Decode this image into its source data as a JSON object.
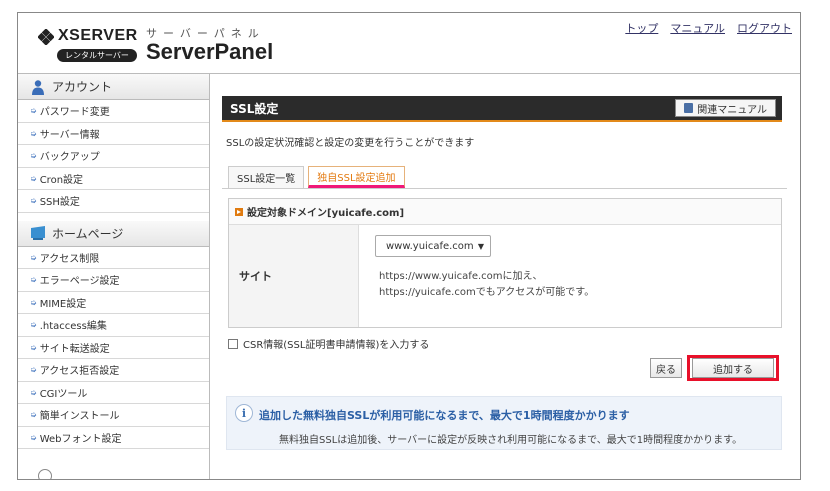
{
  "header": {
    "logo_text": "XSERVER",
    "logo_badge": "レンタルサーバー",
    "panel_kana": "サーバーパネル",
    "panel_title": "ServerPanel",
    "links": [
      "トップ",
      "マニュアル",
      "ログアウト"
    ]
  },
  "sidebar": {
    "account_heading": "アカウント",
    "account_items": [
      "パスワード変更",
      "サーバー情報",
      "バックアップ",
      "Cron設定",
      "SSH設定"
    ],
    "homepage_heading": "ホームページ",
    "homepage_items": [
      "アクセス制限",
      "エラーページ設定",
      "MIME設定",
      ".htaccess編集",
      "サイト転送設定",
      "アクセス拒否設定",
      "CGIツール",
      "簡単インストール",
      "Webフォント設定"
    ]
  },
  "main": {
    "title": "SSL設定",
    "manual_button": "関連マニュアル",
    "description": "SSLの設定状況確認と設定の変更を行うことができます",
    "tabs": [
      {
        "label": "SSL設定一覧",
        "active": false
      },
      {
        "label": "独自SSL設定追加",
        "active": true
      }
    ],
    "domain_heading": "設定対象ドメイン[yuicafe.com]",
    "site_label": "サイト",
    "domain_select_value": "www.yuicafe.com",
    "site_note_line1": "https://www.yuicafe.comに加え、",
    "site_note_line2": "https://yuicafe.comでもアクセスが可能です。",
    "csr_label": "CSR情報(SSL証明書申請情報)を入力する",
    "back_button": "戻る",
    "add_button": "追加する",
    "info_title": "追加した無料独自SSLが利用可能になるまで、最大で1時間程度かかります",
    "info_text": "無料独自SSLは追加後、サーバーに設定が反映され利用可能になるまで、最大で1時間程度かかります。"
  },
  "colors": {
    "accent_orange": "#e37a10",
    "tab_underline": "#f01878",
    "highlight_red": "#e8102a",
    "info_blue": "#2b5fa5"
  }
}
